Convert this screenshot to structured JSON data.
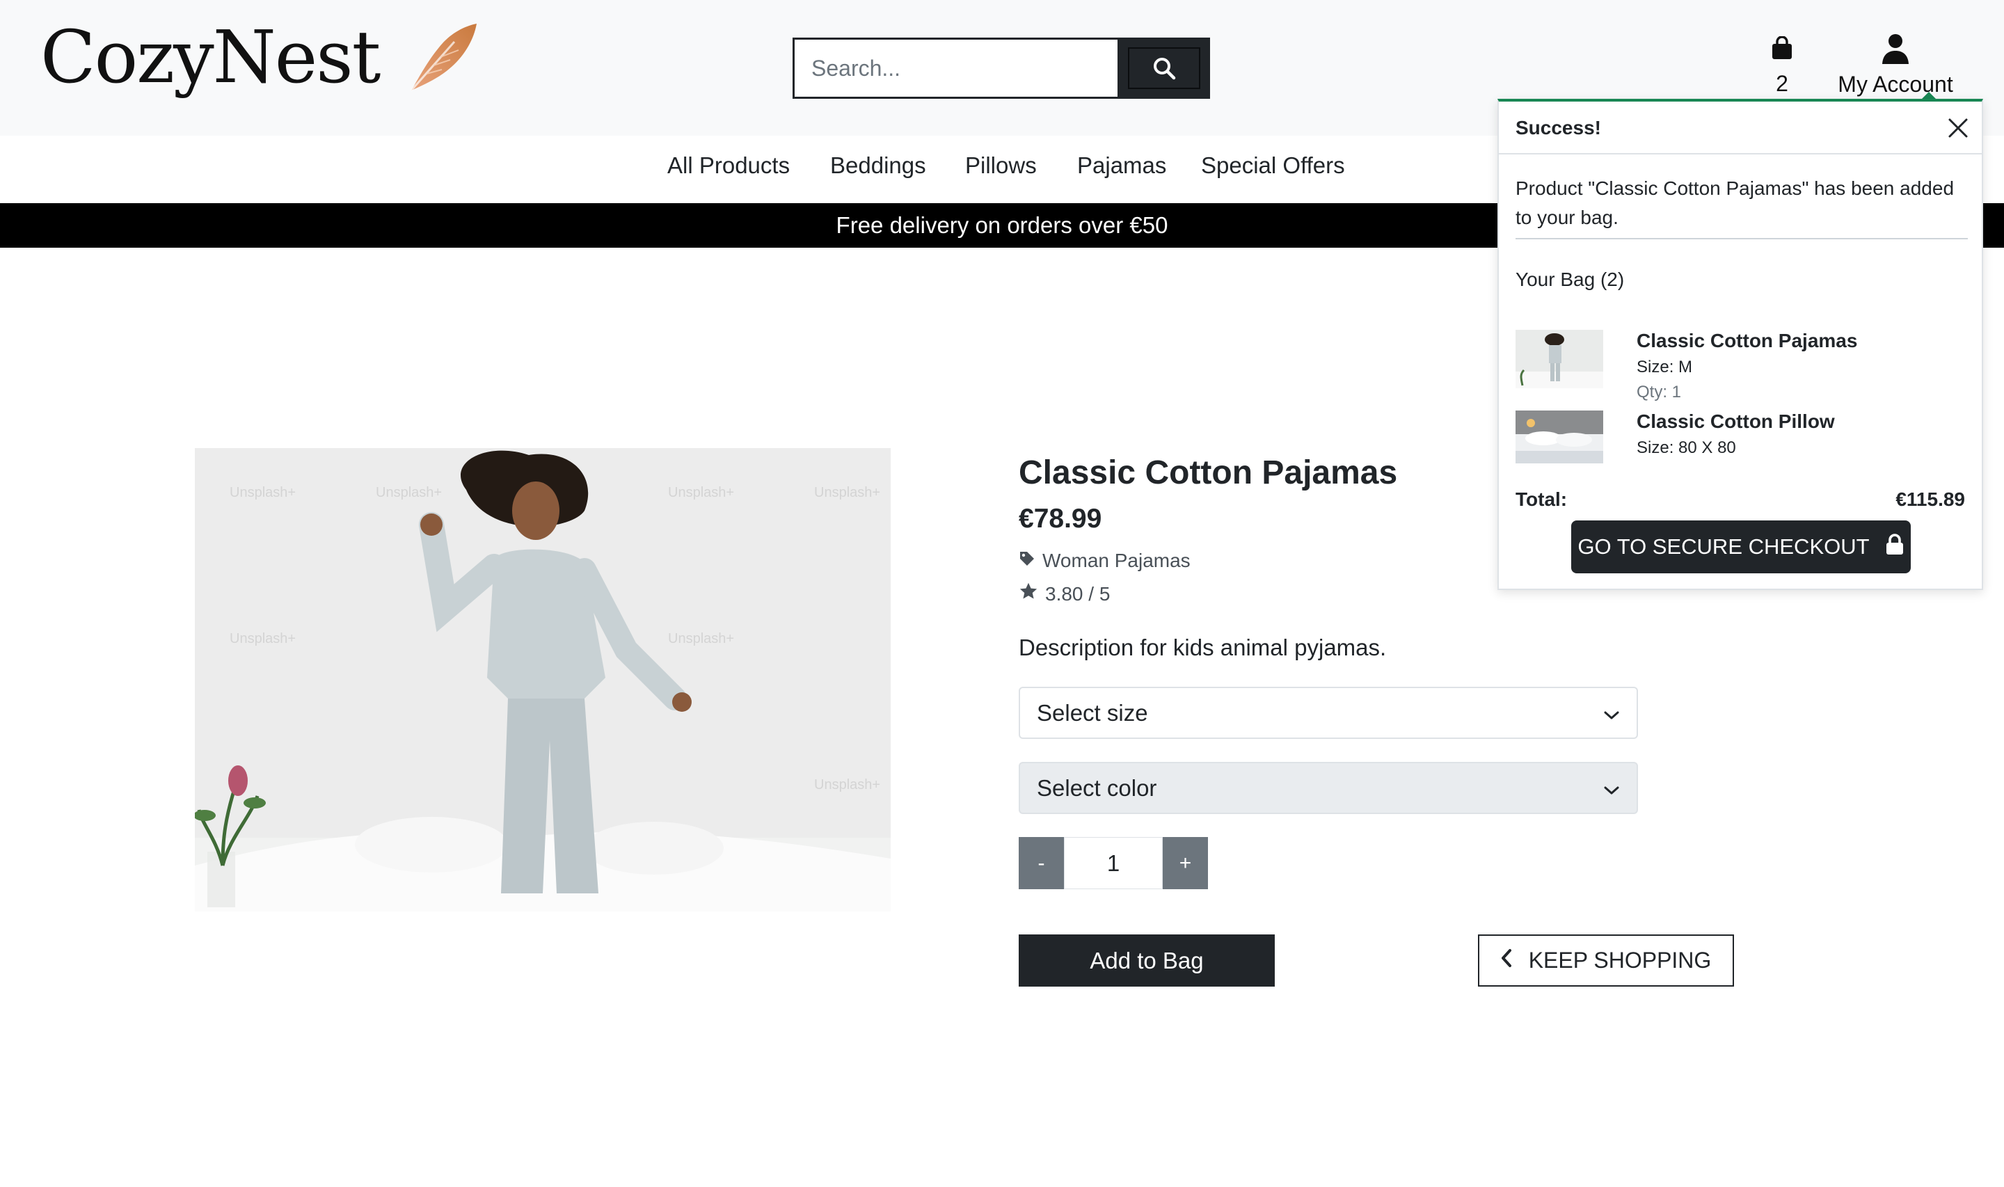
{
  "brand": {
    "name": "CozyNest"
  },
  "search": {
    "placeholder": "Search..."
  },
  "header": {
    "bag_count": "2",
    "account_label": "My Account"
  },
  "nav": {
    "items": [
      "All Products",
      "Beddings",
      "Pillows",
      "Pajamas",
      "Special Offers"
    ]
  },
  "promo": {
    "text": "Free delivery on orders over €50"
  },
  "product": {
    "title": "Classic Cotton Pajamas",
    "price": "€78.99",
    "category": "Woman Pajamas",
    "rating": "3.80 / 5",
    "description": "Description for kids animal pyjamas.",
    "size_placeholder": "Select size",
    "color_placeholder": "Select color",
    "qty_minus": "-",
    "qty_value": "1",
    "qty_plus": "+",
    "add_label": "Add to Bag",
    "keep_label": "KEEP SHOPPING"
  },
  "toast": {
    "title": "Success!",
    "message": "Product \"Classic Cotton Pajamas\" has been added to your bag.",
    "bag_heading": "Your Bag (2)",
    "items": [
      {
        "name": "Classic Cotton Pajamas",
        "size": "Size: M",
        "qty": "Qty: 1"
      },
      {
        "name": "Classic Cotton Pillow",
        "size": "Size: 80 X 80"
      }
    ],
    "total_label": "Total:",
    "total_value": "€115.89",
    "checkout_label": "GO TO SECURE CHECKOUT"
  },
  "colors": {
    "dark": "#212529",
    "success": "#198754",
    "header_bg": "#f8f9fa",
    "secondary": "#6c757d"
  },
  "icons": [
    "feather-logo-icon",
    "search-icon",
    "shopping-bag-icon",
    "user-icon",
    "tag-icon",
    "star-icon",
    "chevron-down-icon",
    "chevron-left-icon",
    "close-icon",
    "lock-icon"
  ]
}
